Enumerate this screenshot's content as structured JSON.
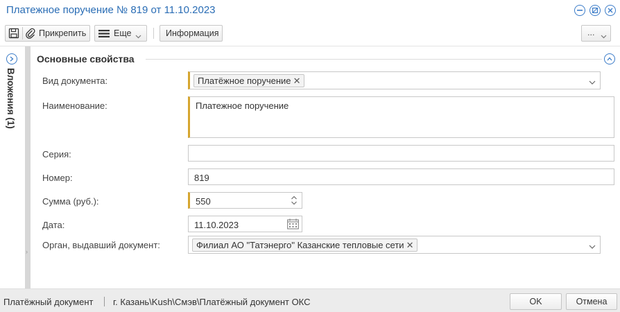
{
  "window": {
    "title": "Платежное поручение № 819 от 11.10.2023"
  },
  "toolbar": {
    "attach_label": "Прикрепить",
    "more_label": "Еще",
    "info_label": "Информация",
    "extra_label": "..."
  },
  "side_panel": {
    "label": "Вложения (1)"
  },
  "section": {
    "title": "Основные свойства"
  },
  "form": {
    "doc_type": {
      "label": "Вид документа:",
      "tag": "Платёжное поручение"
    },
    "name": {
      "label": "Наименование:",
      "value": "Платежное поручение"
    },
    "series": {
      "label": "Серия:",
      "value": ""
    },
    "number": {
      "label": "Номер:",
      "value": "819"
    },
    "amount": {
      "label": "Сумма (руб.):",
      "value": "550"
    },
    "date": {
      "label": "Дата:",
      "value": "11.10.2023"
    },
    "issuer": {
      "label": "Орган, выдавший документ:",
      "tag": "Филиал АО \"Татэнерго\" Казанские тепловые сети"
    }
  },
  "statusbar": {
    "doc_kind": "Платёжный документ",
    "path": "г. Казань\\Kush\\Смэв\\Платёжный документ ОКС",
    "ok_label": "OK",
    "cancel_label": "Отмена"
  },
  "colors": {
    "accent": "#2a6db5",
    "required_marker": "#d6a630",
    "statusbar_bg": "#ececec"
  }
}
